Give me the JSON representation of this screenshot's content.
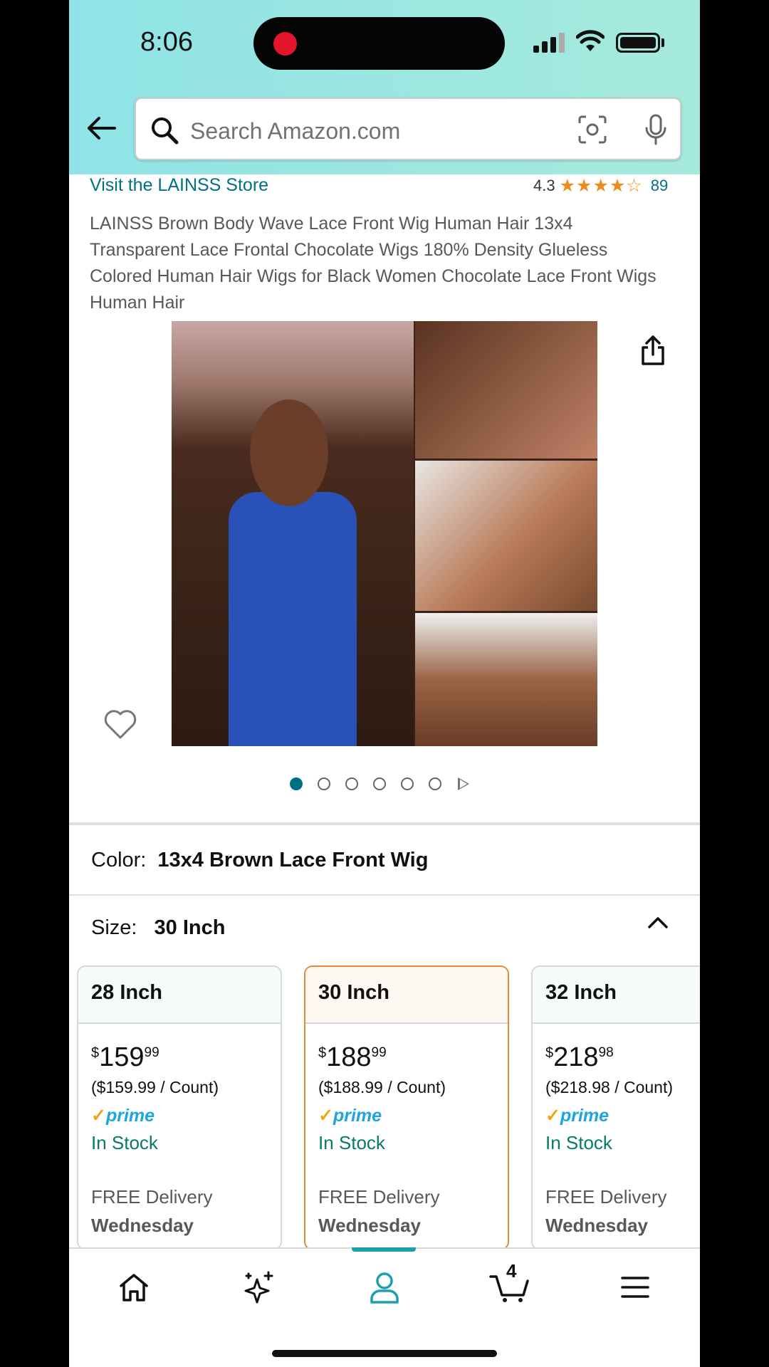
{
  "status_bar": {
    "time": "8:06"
  },
  "search": {
    "placeholder": "Search Amazon.com"
  },
  "store": {
    "link_text": "Visit the LAINSS Store"
  },
  "rating": {
    "value": "4.3",
    "stars": 4.3,
    "count": "89"
  },
  "product": {
    "title": "LAINSS Brown Body Wave Lace Front Wig Human Hair 13x4 Transparent Lace Frontal Chocolate Wigs 180% Density Glueless Colored Human Hair Wigs for Black Women Chocolate Lace Front Wigs Human Hair",
    "image_count": 6,
    "active_image": 1
  },
  "color": {
    "label": "Color:",
    "value": "13x4 Brown Lace Front Wig"
  },
  "size": {
    "label": "Size:",
    "value": "30 Inch",
    "options": [
      {
        "name": "28 Inch",
        "price_symbol": "$",
        "price_whole": "159",
        "price_fraction": "99",
        "unit_price": "($159.99 / Count)",
        "prime": "prime",
        "stock": "In Stock",
        "delivery": "FREE Delivery",
        "day": "Wednesday",
        "selected": false
      },
      {
        "name": "30 Inch",
        "price_symbol": "$",
        "price_whole": "188",
        "price_fraction": "99",
        "unit_price": "($188.99 / Count)",
        "prime": "prime",
        "stock": "In Stock",
        "delivery": "FREE Delivery",
        "day": "Wednesday",
        "selected": true
      },
      {
        "name": "32 Inch",
        "price_symbol": "$",
        "price_whole": "218",
        "price_fraction": "98",
        "unit_price": "($218.98 / Count)",
        "prime": "prime",
        "stock": "In Stock",
        "delivery": "FREE Delivery",
        "day": "Wednesday",
        "selected": false
      }
    ]
  },
  "bottom_nav": {
    "items": [
      {
        "icon": "home-icon"
      },
      {
        "icon": "sparkle-icon"
      },
      {
        "icon": "profile-icon",
        "active": true
      },
      {
        "icon": "cart-icon",
        "badge": "4"
      },
      {
        "icon": "menu-icon"
      }
    ]
  },
  "colors": {
    "accent": "#007185",
    "star": "#f08c16",
    "selected_border": "#e48a33",
    "in_stock": "#067d62",
    "prime": "#1ea4e3"
  }
}
